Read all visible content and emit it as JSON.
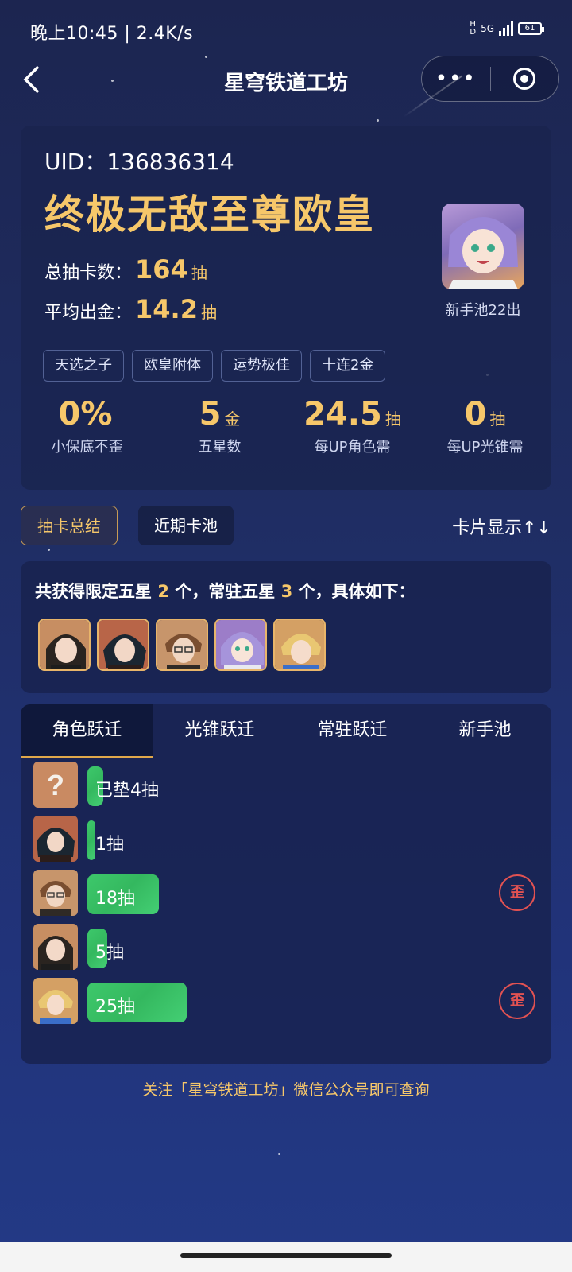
{
  "status_bar": {
    "time": "晚上10:45 | 2.4K/s",
    "network": "5G",
    "battery": "61"
  },
  "nav": {
    "title": "星穹铁道工坊",
    "more_label": "•••"
  },
  "summary": {
    "uid_label": "UID：",
    "uid": "136836314",
    "rank_title": "终极无敌至尊欧皇",
    "total_label": "总抽卡数：",
    "total_value": "164",
    "total_unit": "抽",
    "avg_label": "平均出金：",
    "avg_value": "14.2",
    "avg_unit": "抽",
    "avatar_caption": "新手池22出",
    "tags": [
      "天选之子",
      "欧皇附体",
      "运势极佳",
      "十连2金"
    ],
    "metrics": [
      {
        "value": "0%",
        "unit": "",
        "label": "小保底不歪"
      },
      {
        "value": "5",
        "unit": "金",
        "label": "五星数"
      },
      {
        "value": "24.5",
        "unit": "抽",
        "label": "每UP角色需"
      },
      {
        "value": "0",
        "unit": "抽",
        "label": "每UP光锥需"
      }
    ]
  },
  "tabs": {
    "active": "抽卡总结",
    "inactive": "近期卡池",
    "display_toggle": "卡片显示↑↓"
  },
  "obtained": {
    "prefix": "共获得限定五星",
    "limited_count": "2",
    "middle": "个，常驻五星",
    "standard_count": "3",
    "suffix": "个，具体如下："
  },
  "record": {
    "tabs": [
      "角色跃迁",
      "光锥跃迁",
      "常驻跃迁",
      "新手池"
    ],
    "rows": [
      {
        "label": "已垫4抽",
        "pulls": 4,
        "wai": false,
        "avatar": "question-mark"
      },
      {
        "label": "1抽",
        "pulls": 1,
        "wai": false,
        "avatar": "dark-hair-male"
      },
      {
        "label": "18抽",
        "pulls": 18,
        "wai": true,
        "avatar": "glasses-male"
      },
      {
        "label": "5抽",
        "pulls": 5,
        "wai": false,
        "avatar": "dark-hair-female"
      },
      {
        "label": "25抽",
        "pulls": 25,
        "wai": true,
        "avatar": "blonde-male"
      }
    ],
    "wai_label": "歪"
  },
  "footer_note": "关注「星穹铁道工坊」微信公众号即可查询",
  "colors": {
    "gold": "#f6c76a",
    "green_bar": "#3dc86b",
    "wai_red": "#e25252",
    "card_bg": "#1a244e"
  }
}
